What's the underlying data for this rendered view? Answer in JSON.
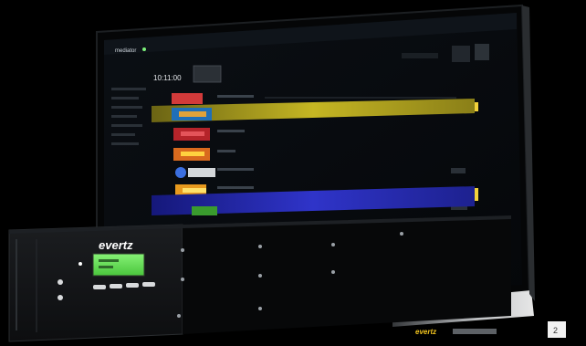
{
  "screen_ui": {
    "header": {
      "app_name": "mediator",
      "clock": "10:11:00"
    },
    "sidebar": {
      "items": [
        "",
        "",
        "",
        "",
        "",
        "",
        ""
      ]
    },
    "playlist": {
      "rows": [
        {
          "highlight": "none"
        },
        {
          "highlight": "yellow"
        },
        {
          "highlight": "none"
        },
        {
          "highlight": "none"
        },
        {
          "highlight": "none"
        },
        {
          "highlight": "none"
        },
        {
          "highlight": "none"
        },
        {
          "highlight": "blue"
        }
      ]
    },
    "colors": {
      "background": "#07090c",
      "panel": "#0d1116",
      "highlight_yellow": "#b3a51a",
      "highlight_blue": "#2a2fb8",
      "accent_green": "#7cf07a",
      "monitor_bezel": "#c9cdd1"
    }
  },
  "monitor_brand": {
    "logo": "evertz"
  },
  "device": {
    "logo": "evertz",
    "display_color": "#69e05a",
    "buttons": [
      "",
      "",
      "",
      ""
    ]
  },
  "corner_mark": {
    "label": "2"
  }
}
